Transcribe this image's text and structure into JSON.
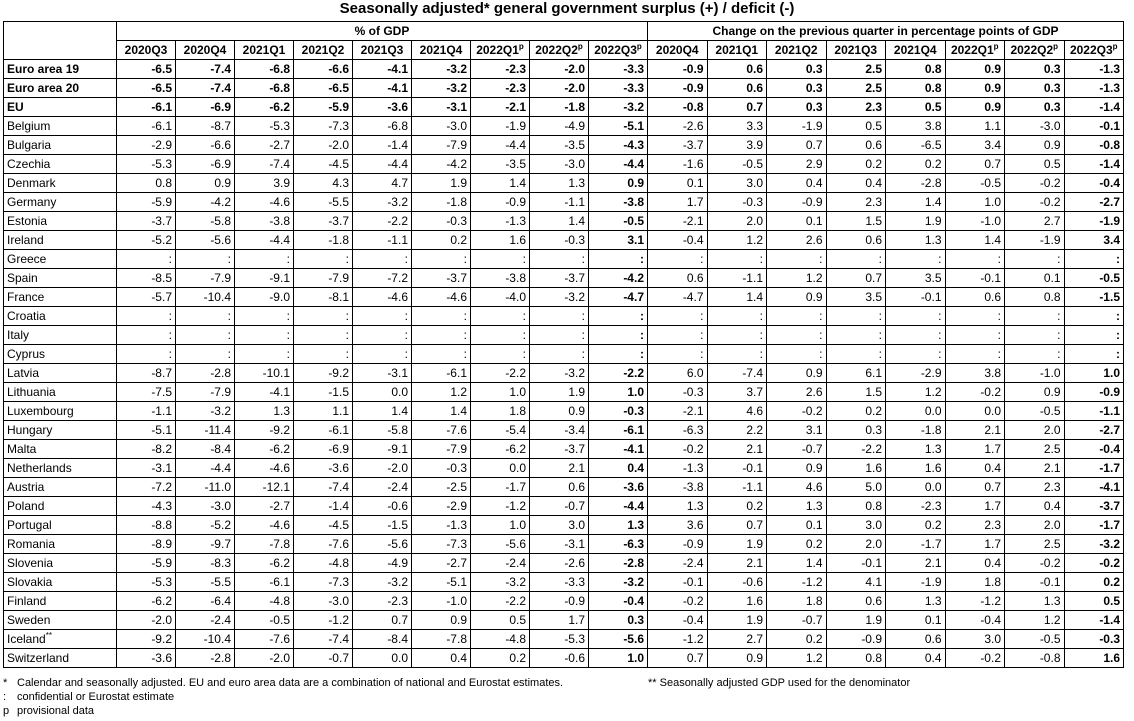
{
  "title": "Seasonally adjusted* general government surplus (+) / deficit (-)",
  "groups": {
    "pct_gdp": "% of GDP",
    "change": "Change on the previous quarter in percentage points of GDP"
  },
  "pct_quarters": [
    "2020Q3",
    "2020Q4",
    "2021Q1",
    "2021Q2",
    "2021Q3",
    "2021Q4",
    "2022Q1",
    "2022Q2",
    "2022Q3"
  ],
  "pct_quarter_flags": [
    "",
    "",
    "",
    "",
    "",
    "",
    "p",
    "p",
    "p"
  ],
  "chg_quarters": [
    "2020Q4",
    "2021Q1",
    "2021Q2",
    "2021Q3",
    "2021Q4",
    "2022Q1",
    "2022Q2",
    "2022Q3"
  ],
  "chg_quarter_flags": [
    "",
    "",
    "",
    "",
    "",
    "p",
    "p",
    "p"
  ],
  "rows": [
    {
      "name": "Euro area 19",
      "flag": "",
      "agg": true,
      "pct": [
        "-6.5",
        "-7.4",
        "-6.8",
        "-6.6",
        "-4.1",
        "-3.2",
        "-2.3",
        "-2.0",
        "-3.3"
      ],
      "chg": [
        "-0.9",
        "0.6",
        "0.3",
        "2.5",
        "0.8",
        "0.9",
        "0.3",
        "-1.3"
      ]
    },
    {
      "name": "Euro area 20",
      "flag": "",
      "agg": true,
      "pct": [
        "-6.5",
        "-7.4",
        "-6.8",
        "-6.5",
        "-4.1",
        "-3.2",
        "-2.3",
        "-2.0",
        "-3.3"
      ],
      "chg": [
        "-0.9",
        "0.6",
        "0.3",
        "2.5",
        "0.8",
        "0.9",
        "0.3",
        "-1.3"
      ]
    },
    {
      "name": "EU",
      "flag": "",
      "agg": true,
      "pct": [
        "-6.1",
        "-6.9",
        "-6.2",
        "-5.9",
        "-3.6",
        "-3.1",
        "-2.1",
        "-1.8",
        "-3.2"
      ],
      "chg": [
        "-0.8",
        "0.7",
        "0.3",
        "2.3",
        "0.5",
        "0.9",
        "0.3",
        "-1.4"
      ]
    },
    {
      "name": "Belgium",
      "flag": "",
      "pct": [
        "-6.1",
        "-8.7",
        "-5.3",
        "-7.3",
        "-6.8",
        "-3.0",
        "-1.9",
        "-4.9",
        "-5.1"
      ],
      "chg": [
        "-2.6",
        "3.3",
        "-1.9",
        "0.5",
        "3.8",
        "1.1",
        "-3.0",
        "-0.1"
      ]
    },
    {
      "name": "Bulgaria",
      "flag": "",
      "pct": [
        "-2.9",
        "-6.6",
        "-2.7",
        "-2.0",
        "-1.4",
        "-7.9",
        "-4.4",
        "-3.5",
        "-4.3"
      ],
      "chg": [
        "-3.7",
        "3.9",
        "0.7",
        "0.6",
        "-6.5",
        "3.4",
        "0.9",
        "-0.8"
      ]
    },
    {
      "name": "Czechia",
      "flag": "",
      "pct": [
        "-5.3",
        "-6.9",
        "-7.4",
        "-4.5",
        "-4.4",
        "-4.2",
        "-3.5",
        "-3.0",
        "-4.4"
      ],
      "chg": [
        "-1.6",
        "-0.5",
        "2.9",
        "0.2",
        "0.2",
        "0.7",
        "0.5",
        "-1.4"
      ]
    },
    {
      "name": "Denmark",
      "flag": "",
      "pct": [
        "0.8",
        "0.9",
        "3.9",
        "4.3",
        "4.7",
        "1.9",
        "1.4",
        "1.3",
        "0.9"
      ],
      "chg": [
        "0.1",
        "3.0",
        "0.4",
        "0.4",
        "-2.8",
        "-0.5",
        "-0.2",
        "-0.4"
      ]
    },
    {
      "name": "Germany",
      "flag": "",
      "pct": [
        "-5.9",
        "-4.2",
        "-4.6",
        "-5.5",
        "-3.2",
        "-1.8",
        "-0.9",
        "-1.1",
        "-3.8"
      ],
      "chg": [
        "1.7",
        "-0.3",
        "-0.9",
        "2.3",
        "1.4",
        "1.0",
        "-0.2",
        "-2.7"
      ]
    },
    {
      "name": "Estonia",
      "flag": "",
      "pct": [
        "-3.7",
        "-5.8",
        "-3.8",
        "-3.7",
        "-2.2",
        "-0.3",
        "-1.3",
        "1.4",
        "-0.5"
      ],
      "chg": [
        "-2.1",
        "2.0",
        "0.1",
        "1.5",
        "1.9",
        "-1.0",
        "2.7",
        "-1.9"
      ]
    },
    {
      "name": "Ireland",
      "flag": "",
      "pct": [
        "-5.2",
        "-5.6",
        "-4.4",
        "-1.8",
        "-1.1",
        "0.2",
        "1.6",
        "-0.3",
        "3.1"
      ],
      "chg": [
        "-0.4",
        "1.2",
        "2.6",
        "0.6",
        "1.3",
        "1.4",
        "-1.9",
        "3.4"
      ]
    },
    {
      "name": "Greece",
      "flag": "",
      "pct": [
        ":",
        ":",
        ":",
        ":",
        ":",
        ":",
        ":",
        ":",
        ":"
      ],
      "chg": [
        ":",
        ":",
        ":",
        ":",
        ":",
        ":",
        ":",
        ":"
      ]
    },
    {
      "name": "Spain",
      "flag": "",
      "pct": [
        "-8.5",
        "-7.9",
        "-9.1",
        "-7.9",
        "-7.2",
        "-3.7",
        "-3.8",
        "-3.7",
        "-4.2"
      ],
      "chg": [
        "0.6",
        "-1.1",
        "1.2",
        "0.7",
        "3.5",
        "-0.1",
        "0.1",
        "-0.5"
      ]
    },
    {
      "name": "France",
      "flag": "",
      "pct": [
        "-5.7",
        "-10.4",
        "-9.0",
        "-8.1",
        "-4.6",
        "-4.6",
        "-4.0",
        "-3.2",
        "-4.7"
      ],
      "chg": [
        "-4.7",
        "1.4",
        "0.9",
        "3.5",
        "-0.1",
        "0.6",
        "0.8",
        "-1.5"
      ]
    },
    {
      "name": "Croatia",
      "flag": "",
      "pct": [
        ":",
        ":",
        ":",
        ":",
        ":",
        ":",
        ":",
        ":",
        ":"
      ],
      "chg": [
        ":",
        ":",
        ":",
        ":",
        ":",
        ":",
        ":",
        ":"
      ]
    },
    {
      "name": "Italy",
      "flag": "",
      "pct": [
        ":",
        ":",
        ":",
        ":",
        ":",
        ":",
        ":",
        ":",
        ":"
      ],
      "chg": [
        ":",
        ":",
        ":",
        ":",
        ":",
        ":",
        ":",
        ":"
      ]
    },
    {
      "name": "Cyprus",
      "flag": "",
      "pct": [
        ":",
        ":",
        ":",
        ":",
        ":",
        ":",
        ":",
        ":",
        ":"
      ],
      "chg": [
        ":",
        ":",
        ":",
        ":",
        ":",
        ":",
        ":",
        ":"
      ]
    },
    {
      "name": "Latvia",
      "flag": "",
      "pct": [
        "-8.7",
        "-2.8",
        "-10.1",
        "-9.2",
        "-3.1",
        "-6.1",
        "-2.2",
        "-3.2",
        "-2.2"
      ],
      "chg": [
        "6.0",
        "-7.4",
        "0.9",
        "6.1",
        "-2.9",
        "3.8",
        "-1.0",
        "1.0"
      ]
    },
    {
      "name": "Lithuania",
      "flag": "",
      "pct": [
        "-7.5",
        "-7.9",
        "-4.1",
        "-1.5",
        "0.0",
        "1.2",
        "1.0",
        "1.9",
        "1.0"
      ],
      "chg": [
        "-0.3",
        "3.7",
        "2.6",
        "1.5",
        "1.2",
        "-0.2",
        "0.9",
        "-0.9"
      ]
    },
    {
      "name": "Luxembourg",
      "flag": "",
      "pct": [
        "-1.1",
        "-3.2",
        "1.3",
        "1.1",
        "1.4",
        "1.4",
        "1.8",
        "0.9",
        "-0.3"
      ],
      "chg": [
        "-2.1",
        "4.6",
        "-0.2",
        "0.2",
        "0.0",
        "0.0",
        "-0.5",
        "-1.1"
      ]
    },
    {
      "name": "Hungary",
      "flag": "",
      "pct": [
        "-5.1",
        "-11.4",
        "-9.2",
        "-6.1",
        "-5.8",
        "-7.6",
        "-5.4",
        "-3.4",
        "-6.1"
      ],
      "chg": [
        "-6.3",
        "2.2",
        "3.1",
        "0.3",
        "-1.8",
        "2.1",
        "2.0",
        "-2.7"
      ]
    },
    {
      "name": "Malta",
      "flag": "",
      "pct": [
        "-8.2",
        "-8.4",
        "-6.2",
        "-6.9",
        "-9.1",
        "-7.9",
        "-6.2",
        "-3.7",
        "-4.1"
      ],
      "chg": [
        "-0.2",
        "2.1",
        "-0.7",
        "-2.2",
        "1.3",
        "1.7",
        "2.5",
        "-0.4"
      ]
    },
    {
      "name": "Netherlands",
      "flag": "",
      "pct": [
        "-3.1",
        "-4.4",
        "-4.6",
        "-3.6",
        "-2.0",
        "-0.3",
        "0.0",
        "2.1",
        "0.4"
      ],
      "chg": [
        "-1.3",
        "-0.1",
        "0.9",
        "1.6",
        "1.6",
        "0.4",
        "2.1",
        "-1.7"
      ]
    },
    {
      "name": "Austria",
      "flag": "",
      "pct": [
        "-7.2",
        "-11.0",
        "-12.1",
        "-7.4",
        "-2.4",
        "-2.5",
        "-1.7",
        "0.6",
        "-3.6"
      ],
      "chg": [
        "-3.8",
        "-1.1",
        "4.6",
        "5.0",
        "0.0",
        "0.7",
        "2.3",
        "-4.1"
      ]
    },
    {
      "name": "Poland",
      "flag": "",
      "pct": [
        "-4.3",
        "-3.0",
        "-2.7",
        "-1.4",
        "-0.6",
        "-2.9",
        "-1.2",
        "-0.7",
        "-4.4"
      ],
      "chg": [
        "1.3",
        "0.2",
        "1.3",
        "0.8",
        "-2.3",
        "1.7",
        "0.4",
        "-3.7"
      ]
    },
    {
      "name": "Portugal",
      "flag": "",
      "pct": [
        "-8.8",
        "-5.2",
        "-4.6",
        "-4.5",
        "-1.5",
        "-1.3",
        "1.0",
        "3.0",
        "1.3"
      ],
      "chg": [
        "3.6",
        "0.7",
        "0.1",
        "3.0",
        "0.2",
        "2.3",
        "2.0",
        "-1.7"
      ]
    },
    {
      "name": "Romania",
      "flag": "",
      "pct": [
        "-8.9",
        "-9.7",
        "-7.8",
        "-7.6",
        "-5.6",
        "-7.3",
        "-5.6",
        "-3.1",
        "-6.3"
      ],
      "chg": [
        "-0.9",
        "1.9",
        "0.2",
        "2.0",
        "-1.7",
        "1.7",
        "2.5",
        "-3.2"
      ]
    },
    {
      "name": "Slovenia",
      "flag": "",
      "pct": [
        "-5.9",
        "-8.3",
        "-6.2",
        "-4.8",
        "-4.9",
        "-2.7",
        "-2.4",
        "-2.6",
        "-2.8"
      ],
      "chg": [
        "-2.4",
        "2.1",
        "1.4",
        "-0.1",
        "2.1",
        "0.4",
        "-0.2",
        "-0.2"
      ]
    },
    {
      "name": "Slovakia",
      "flag": "",
      "pct": [
        "-5.3",
        "-5.5",
        "-6.1",
        "-7.3",
        "-3.2",
        "-5.1",
        "-3.2",
        "-3.3",
        "-3.2"
      ],
      "chg": [
        "-0.1",
        "-0.6",
        "-1.2",
        "4.1",
        "-1.9",
        "1.8",
        "-0.1",
        "0.2"
      ]
    },
    {
      "name": "Finland",
      "flag": "",
      "pct": [
        "-6.2",
        "-6.4",
        "-4.8",
        "-3.0",
        "-2.3",
        "-1.0",
        "-2.2",
        "-0.9",
        "-0.4"
      ],
      "chg": [
        "-0.2",
        "1.6",
        "1.8",
        "0.6",
        "1.3",
        "-1.2",
        "1.3",
        "0.5"
      ]
    },
    {
      "name": "Sweden",
      "flag": "",
      "pct": [
        "-2.0",
        "-2.4",
        "-0.5",
        "-1.2",
        "0.7",
        "0.9",
        "0.5",
        "1.7",
        "0.3"
      ],
      "chg": [
        "-0.4",
        "1.9",
        "-0.7",
        "1.9",
        "0.1",
        "-0.4",
        "1.2",
        "-1.4"
      ]
    },
    {
      "name": "Iceland",
      "flag": "**",
      "pct": [
        "-9.2",
        "-10.4",
        "-7.6",
        "-7.4",
        "-8.4",
        "-7.8",
        "-4.8",
        "-5.3",
        "-5.6"
      ],
      "chg": [
        "-1.2",
        "2.7",
        "0.2",
        "-0.9",
        "0.6",
        "3.0",
        "-0.5",
        "-0.3"
      ]
    },
    {
      "name": "Switzerland",
      "flag": "",
      "pct": [
        "-3.6",
        "-2.8",
        "-2.0",
        "-0.7",
        "0.0",
        "0.4",
        "0.2",
        "-0.6",
        "1.0"
      ],
      "chg": [
        "0.7",
        "0.9",
        "1.2",
        "0.8",
        "0.4",
        "-0.2",
        "-0.8",
        "1.6"
      ]
    }
  ],
  "notes": {
    "n1_sym": "*",
    "n1": "Calendar and seasonally adjusted. EU and euro area data are a combination of national and Eurostat estimates.",
    "n2_sym": ":",
    "n2": "confidential or Eurostat estimate",
    "n3_sym": "p",
    "n3": "provisional data",
    "n4": "** Seasonally adjusted GDP used for the denominator"
  }
}
